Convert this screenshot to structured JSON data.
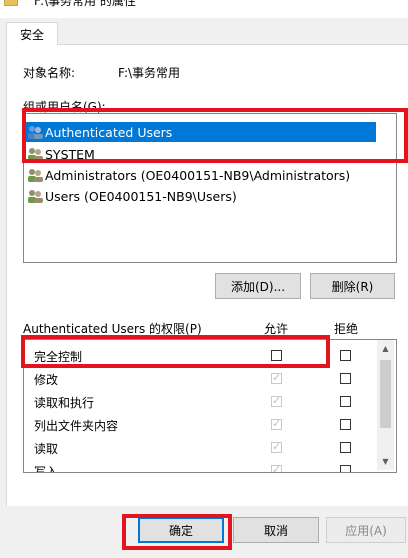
{
  "window": {
    "title": "F:\\事务常用 的属性"
  },
  "tabs": [
    {
      "label": "安全"
    }
  ],
  "object": {
    "label": "对象名称:",
    "value": "F:\\事务常用"
  },
  "groups": {
    "label": "组或用户名(G):",
    "items": [
      {
        "label": "Authenticated Users"
      },
      {
        "label": "SYSTEM"
      },
      {
        "label": "Administrators (OE0400151-NB9\\Administrators)"
      },
      {
        "label": "Users (OE0400151-NB9\\Users)"
      }
    ],
    "selected_index": 0
  },
  "buttons": {
    "add": "添加(D)...",
    "remove": "删除(R)",
    "ok": "确定",
    "cancel": "取消",
    "apply": "应用(A)"
  },
  "permissions": {
    "label": "Authenticated Users 的权限(P)",
    "allow_header": "允许",
    "deny_header": "拒绝",
    "rows": [
      {
        "name": "完全控制",
        "allow": false,
        "allow_disabled": false,
        "deny": false
      },
      {
        "name": "修改",
        "allow": true,
        "allow_disabled": true,
        "deny": false
      },
      {
        "name": "读取和执行",
        "allow": true,
        "allow_disabled": true,
        "deny": false
      },
      {
        "name": "列出文件夹内容",
        "allow": true,
        "allow_disabled": true,
        "deny": false
      },
      {
        "name": "读取",
        "allow": true,
        "allow_disabled": true,
        "deny": false
      },
      {
        "name": "写入",
        "allow": true,
        "allow_disabled": true,
        "deny": false
      }
    ]
  },
  "icons": {
    "user_group": "users-icon",
    "scroll_up": "scroll-up-icon",
    "scroll_down": "scroll-down-icon",
    "checkmark": "✓"
  },
  "colors": {
    "selection": "#0078d7",
    "highlight_box": "#e3141d"
  }
}
